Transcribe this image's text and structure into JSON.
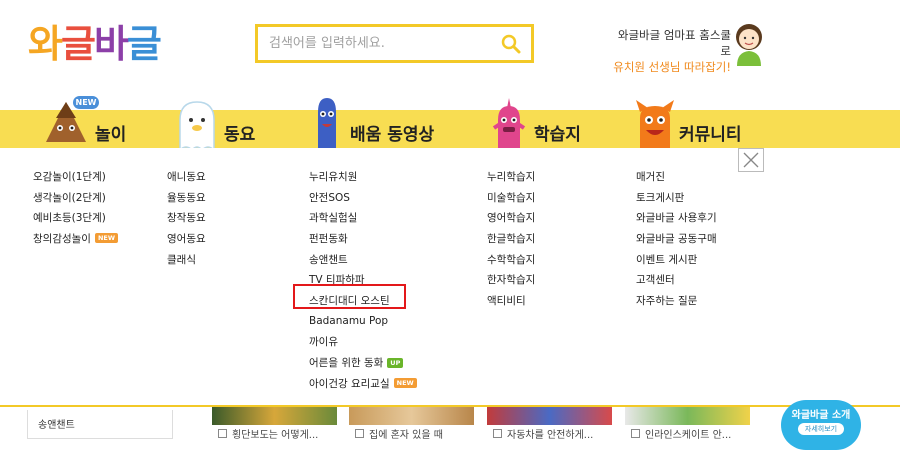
{
  "logo": {
    "text": "와글바글",
    "colors": [
      "#f5a623",
      "#e94f3e",
      "#8c3fa8",
      "#3a8fd6"
    ]
  },
  "search": {
    "placeholder": "검색어를 입력하세요.",
    "icon": "search-icon"
  },
  "promo": {
    "line1": "와글바글 엄마표 홈스쿨로",
    "line2": "유치원 선생님 따라잡기!"
  },
  "nav": {
    "new_badge": "NEW",
    "items": [
      {
        "label": "놀이",
        "icon": "chestnut-character-icon"
      },
      {
        "label": "동요",
        "icon": "ghost-character-icon"
      },
      {
        "label": "배움 동영상",
        "icon": "blue-character-icon"
      },
      {
        "label": "학습지",
        "icon": "pink-character-icon"
      },
      {
        "label": "커뮤니티",
        "icon": "orange-character-icon"
      }
    ]
  },
  "menu": {
    "col1": [
      {
        "label": "오감놀이(1단계)"
      },
      {
        "label": "생각놀이(2단계)"
      },
      {
        "label": "예비초등(3단계)"
      },
      {
        "label": "창의감성놀이",
        "tag": "NEW"
      }
    ],
    "col2": [
      {
        "label": "애니동요"
      },
      {
        "label": "율동동요"
      },
      {
        "label": "창작동요"
      },
      {
        "label": "영어동요"
      },
      {
        "label": "클래식"
      }
    ],
    "col3": [
      {
        "label": "누리유치원"
      },
      {
        "label": "안전SOS"
      },
      {
        "label": "과학실험실"
      },
      {
        "label": "펀펀동화"
      },
      {
        "label": "송앤챈트"
      },
      {
        "label": "TV 티파하파"
      },
      {
        "label": "스칸디대디 오스틴"
      },
      {
        "label": "Badanamu Pop"
      },
      {
        "label": "까이유"
      },
      {
        "label": "어른을 위한 동화",
        "tag": "UP"
      },
      {
        "label": "아이건강 요리교실",
        "tag": "NEW"
      }
    ],
    "col4": [
      {
        "label": "누리학습지"
      },
      {
        "label": "미술학습지"
      },
      {
        "label": "영어학습지"
      },
      {
        "label": "한글학습지"
      },
      {
        "label": "수학학습지"
      },
      {
        "label": "한자학습지"
      },
      {
        "label": "액티비티"
      }
    ],
    "col5": [
      {
        "label": "매거진"
      },
      {
        "label": "토크게시판"
      },
      {
        "label": "와글바글 사용후기"
      },
      {
        "label": "와글바글 공동구매"
      },
      {
        "label": "이벤트 게시판"
      },
      {
        "label": "고객센터"
      },
      {
        "label": "자주하는 질문"
      }
    ]
  },
  "bottom": {
    "sidebar_item": "송앤챈트",
    "captions": [
      "횡단보도는 어떻게...",
      "집에 혼자 있을 때",
      "자동차를 안전하게...",
      "인라인스케이트 안..."
    ],
    "promo_title": "와글바글 소개",
    "promo_button": "자세히보기"
  },
  "colors": {
    "nav_bar": "#f8dd52",
    "search_border": "#f3c927",
    "highlight": "#e3181a",
    "promo_orange": "#f08a1e"
  }
}
